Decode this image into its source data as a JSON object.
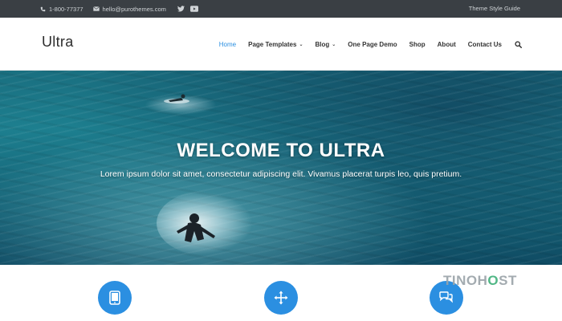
{
  "topbar": {
    "phone": "1-800-77377",
    "email": "hello@purothemes.com",
    "social_icons": [
      "twitter-icon",
      "youtube-icon"
    ],
    "style_guide": "Theme Style Guide"
  },
  "header": {
    "logo": "Ultra",
    "nav": [
      {
        "label": "Home",
        "active": true
      },
      {
        "label": "Page Templates",
        "dropdown": true
      },
      {
        "label": "Blog",
        "dropdown": true
      },
      {
        "label": "One Page Demo"
      },
      {
        "label": "Shop"
      },
      {
        "label": "About"
      },
      {
        "label": "Contact Us"
      }
    ],
    "search_icon": "search-icon"
  },
  "hero": {
    "title": "WELCOME TO ULTRA",
    "subtitle": "Lorem ipsum dolor sit amet, consectetur adipiscing elit. Vivamus placerat turpis leo, quis pretium."
  },
  "features": [
    {
      "icon": "tablet-icon"
    },
    {
      "icon": "move-arrows-icon"
    },
    {
      "icon": "chat-bubbles-icon"
    }
  ],
  "watermark": {
    "pre": "TINOH",
    "mid": "O",
    "post": "ST"
  },
  "colors": {
    "accent": "#2b8fe1",
    "topbar_bg": "#3a3f44",
    "hero_water": "#1a6f80"
  }
}
